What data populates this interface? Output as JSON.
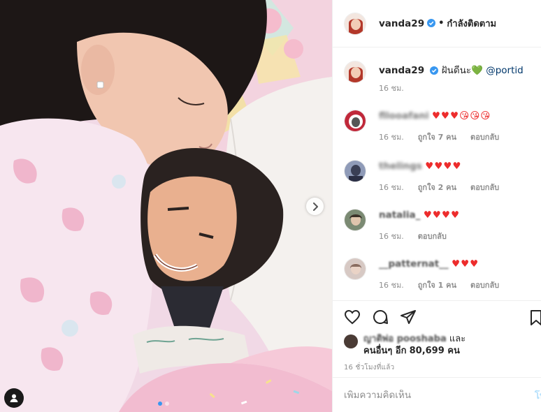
{
  "post": {
    "author": "vanda29",
    "follow_separator": "•",
    "follow_status": "กำลังติดตาม"
  },
  "caption": {
    "author": "vanda29",
    "text": "ฝันดีนะ",
    "heart": "💚",
    "mention": "@portid",
    "time": "16 ชม."
  },
  "comments": [
    {
      "user": "fllooafani",
      "text": "♥♥♥😘😘😘",
      "time": "16 ชม.",
      "likes": "ถูกใจ 7 คน",
      "reply": "ตอบกลับ"
    },
    {
      "user": "thelings",
      "text": "♥♥♥♥",
      "time": "16 ชม.",
      "likes": "ถูกใจ 2 คน",
      "reply": "ตอบกลับ"
    },
    {
      "user": "natalia_",
      "text": "♥♥♥♥",
      "time": "16 ชม.",
      "likes": "",
      "reply": "ตอบกลับ"
    },
    {
      "user": "__patternat__",
      "text": "♥♥♥",
      "time": "16 ชม.",
      "likes": "ถูกใจ 1 คน",
      "reply": "ตอบกลับ"
    }
  ],
  "likes": {
    "line1_user": "ญาติพ่อ pooshaba",
    "line1_suffix": "และ",
    "line2_prefix": "คนอื่นๆ อีก",
    "count": "80,699 คน"
  },
  "time_ago": "16 ชั่วโมงที่แล้ว",
  "add_comment": {
    "placeholder": "เพิ่มความคิดเห็น",
    "post_label": "โพ"
  },
  "carousel": {
    "slides": 2,
    "current": 1
  },
  "colors": {
    "link": "#00376b",
    "verified": "#3897f0",
    "heart": "#ed2c2c",
    "muted": "#8e8e8e",
    "post_disabled": "#b2dffc"
  },
  "icons": [
    "next-arrow-icon",
    "user-tag-icon",
    "verified-icon",
    "heart-icon",
    "comment-icon",
    "share-icon",
    "bookmark-icon"
  ]
}
